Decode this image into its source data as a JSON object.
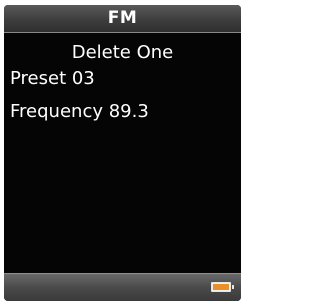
{
  "header": {
    "title": "FM"
  },
  "main": {
    "subtitle": "Delete One",
    "preset_label": "Preset 03",
    "frequency_label": "Frequency 89.3"
  },
  "status_bar": {
    "battery_icon": "battery-icon",
    "battery_level": 1.0,
    "battery_color": "#e8912a"
  }
}
